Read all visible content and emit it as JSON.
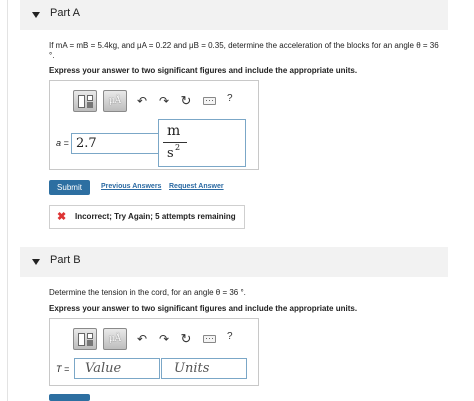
{
  "partA": {
    "title": "Part A",
    "question_line1": "If mA = mB = 5.4kg, and μA = 0.22 and μB = 0.35, determine the acceleration of the blocks for an angle θ = 36",
    "question_line2": "°.",
    "instruction": "Express your answer to two significant figures and include the appropriate units.",
    "toolbar": {
      "symbols_label": "μÅ",
      "help_label": "?"
    },
    "variable_label": "a =",
    "value": "2.7",
    "units": {
      "numerator": "m",
      "denominator": "s",
      "exponent": "2"
    },
    "submit_label": "Submit",
    "previous_answers_label": "Previous Answers",
    "request_answer_label": "Request Answer",
    "feedback": {
      "icon": "✖",
      "message": "Incorrect; Try Again; 5 attempts remaining"
    }
  },
  "partB": {
    "title": "Part B",
    "question": "Determine the tension in the cord, for an angle θ = 36 °.",
    "instruction": "Express your answer to two significant figures and include the appropriate units.",
    "toolbar": {
      "symbols_label": "μÅ",
      "help_label": "?"
    },
    "variable_label": "T =",
    "value_placeholder": "Value",
    "units_placeholder": "Units"
  },
  "colors": {
    "accent": "#2d6fa1",
    "link": "#2b6aa3",
    "error": "#dd3333",
    "field_border": "#7ba7c7"
  },
  "icons": [
    "templates-icon",
    "symbols-icon",
    "undo-icon",
    "redo-icon",
    "reset-icon",
    "keyboard-icon",
    "help-icon",
    "incorrect-x-icon"
  ]
}
